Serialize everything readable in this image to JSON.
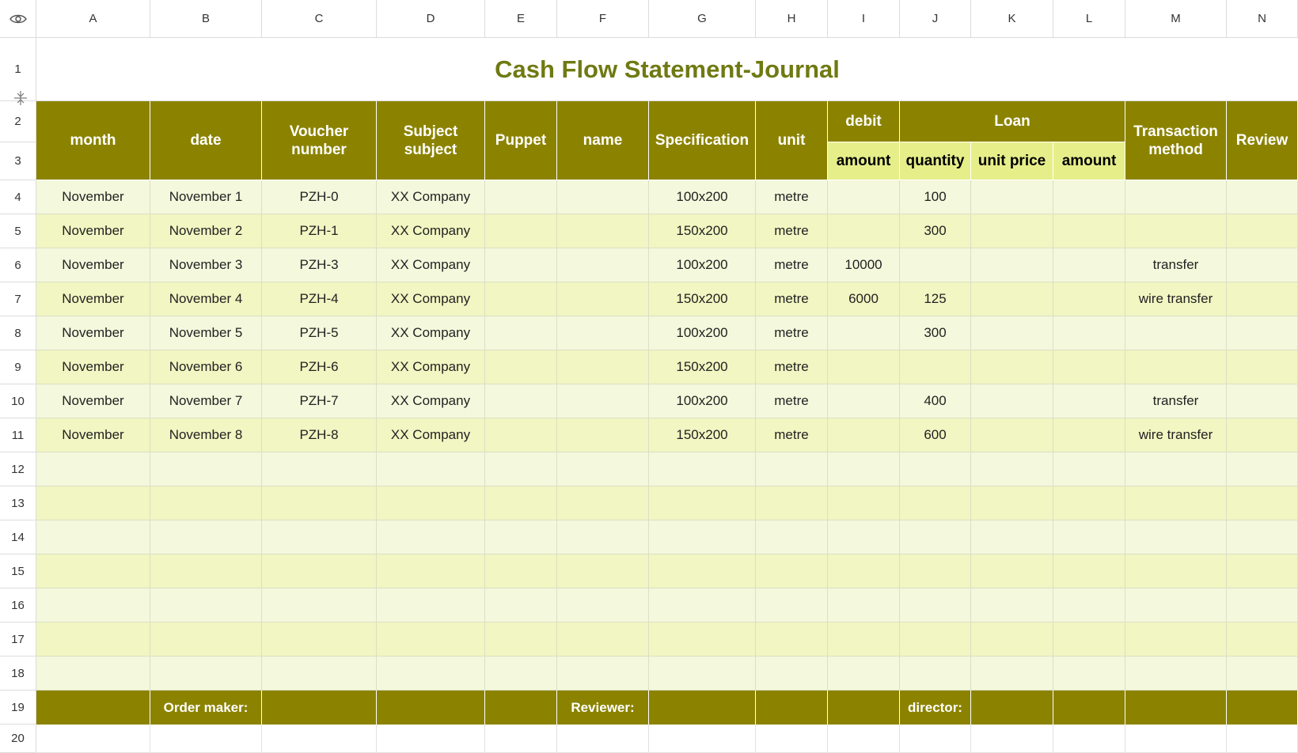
{
  "col_headers": [
    "A",
    "B",
    "C",
    "D",
    "E",
    "F",
    "G",
    "H",
    "I",
    "J",
    "K",
    "L",
    "M",
    "N"
  ],
  "row_headers": [
    "1",
    "2",
    "3",
    "4",
    "5",
    "6",
    "7",
    "8",
    "9",
    "10",
    "11",
    "12",
    "13",
    "14",
    "15",
    "16",
    "17",
    "18",
    "19",
    "20"
  ],
  "title": "Cash Flow Statement-Journal",
  "headers": {
    "month": "month",
    "date": "date",
    "voucher": "Voucher number",
    "subject": "Subject subject",
    "puppet": "Puppet",
    "name": "name",
    "spec": "Specification",
    "unit": "unit",
    "debit": "debit",
    "loan": "Loan",
    "method": "Transaction method",
    "review": "Review",
    "debit_amount": "amount",
    "quantity": "quantity",
    "unit_price": "unit price",
    "loan_amount": "amount"
  },
  "rows": [
    [
      "November",
      "November 1",
      "PZH-0",
      "XX Company",
      "",
      "",
      "100x200",
      "metre",
      "",
      "100",
      "",
      "",
      "",
      ""
    ],
    [
      "November",
      "November 2",
      "PZH-1",
      "XX Company",
      "",
      "",
      "150x200",
      "metre",
      "",
      "300",
      "",
      "",
      "",
      ""
    ],
    [
      "November",
      "November 3",
      "PZH-3",
      "XX Company",
      "",
      "",
      "100x200",
      "metre",
      "10000",
      "",
      "",
      "",
      "transfer",
      ""
    ],
    [
      "November",
      "November 4",
      "PZH-4",
      "XX Company",
      "",
      "",
      "150x200",
      "metre",
      "6000",
      "125",
      "",
      "",
      "wire transfer",
      ""
    ],
    [
      "November",
      "November 5",
      "PZH-5",
      "XX Company",
      "",
      "",
      "100x200",
      "metre",
      "",
      "300",
      "",
      "",
      "",
      ""
    ],
    [
      "November",
      "November 6",
      "PZH-6",
      "XX Company",
      "",
      "",
      "150x200",
      "metre",
      "",
      "",
      "",
      "",
      "",
      ""
    ],
    [
      "November",
      "November 7",
      "PZH-7",
      "XX Company",
      "",
      "",
      "100x200",
      "metre",
      "",
      "400",
      "",
      "",
      "transfer",
      ""
    ],
    [
      "November",
      "November 8",
      "PZH-8",
      "XX Company",
      "",
      "",
      "150x200",
      "metre",
      "",
      "600",
      "",
      "",
      "wire transfer",
      ""
    ],
    [
      "",
      "",
      "",
      "",
      "",
      "",
      "",
      "",
      "",
      "",
      "",
      "",
      "",
      ""
    ],
    [
      "",
      "",
      "",
      "",
      "",
      "",
      "",
      "",
      "",
      "",
      "",
      "",
      "",
      ""
    ],
    [
      "",
      "",
      "",
      "",
      "",
      "",
      "",
      "",
      "",
      "",
      "",
      "",
      "",
      ""
    ],
    [
      "",
      "",
      "",
      "",
      "",
      "",
      "",
      "",
      "",
      "",
      "",
      "",
      "",
      ""
    ],
    [
      "",
      "",
      "",
      "",
      "",
      "",
      "",
      "",
      "",
      "",
      "",
      "",
      "",
      ""
    ],
    [
      "",
      "",
      "",
      "",
      "",
      "",
      "",
      "",
      "",
      "",
      "",
      "",
      "",
      ""
    ],
    [
      "",
      "",
      "",
      "",
      "",
      "",
      "",
      "",
      "",
      "",
      "",
      "",
      "",
      ""
    ]
  ],
  "footer": [
    "",
    "Order maker:",
    "",
    "",
    "",
    "Reviewer:",
    "",
    "",
    "",
    "director:",
    "",
    "",
    "",
    ""
  ],
  "colors": {
    "header_bg": "#8b8300",
    "subheader_bg": "#e6ee8a",
    "title": "#6f7a12",
    "row_light": "#f4f8dc",
    "row_dark": "#f1f6c2"
  },
  "icons": {
    "corner": "eye-icon",
    "row_resize": "row-resize-icon",
    "collapse": "collapse-panel-icon"
  }
}
